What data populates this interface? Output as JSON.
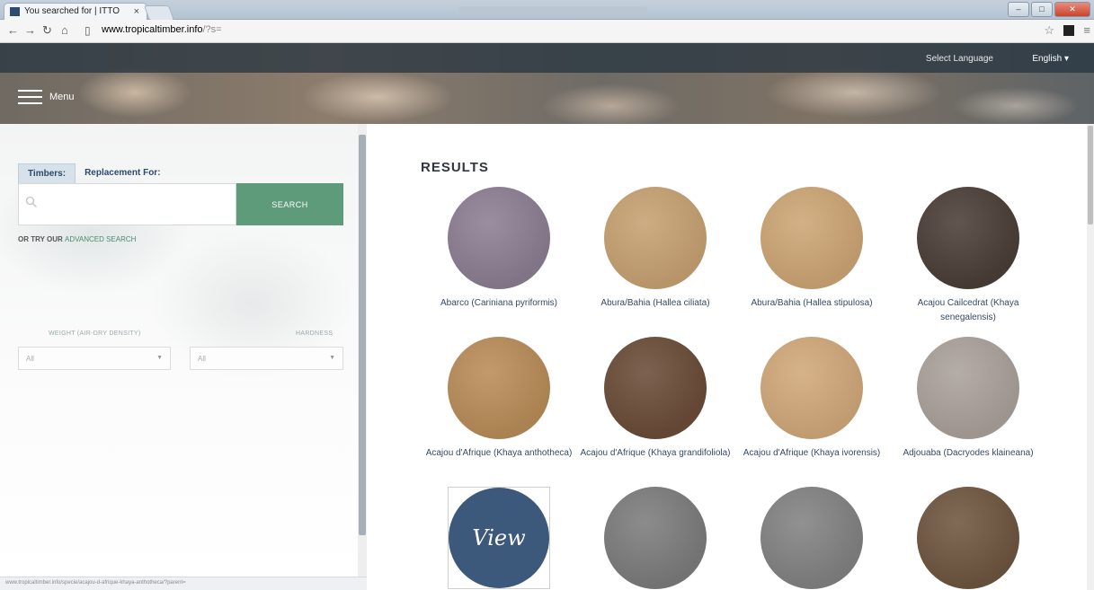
{
  "browser": {
    "tab_title": "You searched for | ITTO",
    "tab_close": "×",
    "url_domain": "www.tropicaltimber.info",
    "url_path": "/?s=",
    "win_min": "–",
    "win_max": "□",
    "win_close": "✕"
  },
  "header": {
    "language_label": "Select Language",
    "language_value": "English ▾",
    "menu_label": "Menu"
  },
  "search": {
    "tabs": [
      "Timbers:",
      "Replacement For:"
    ],
    "placeholder": "",
    "button_label": "SEARCH",
    "advanced_prefix": "OR TRY OUR ",
    "advanced_link": "ADVANCED SEARCH"
  },
  "filters": {
    "weight_label": "WEIGHT (AIR-DRY DENSITY)",
    "hardness_label": "HARDNESS",
    "weight_value": "All",
    "hardness_value": "All"
  },
  "results": {
    "title": "RESULTS",
    "items": [
      {
        "name": "Abarco (Cariniana pyriformis)",
        "color": "#8c7e92"
      },
      {
        "name": "Abura/Bahia (Hallea ciliata)",
        "color": "#c7a172"
      },
      {
        "name": "Abura/Bahia (Hallea stipulosa)",
        "color": "#cda575"
      },
      {
        "name": "Acajou Cailcedrat (Khaya senegalensis)",
        "color": "#4b3f37"
      },
      {
        "name": "Acajou d'Afrique (Khaya anthotheca)",
        "color": "#b98c58"
      },
      {
        "name": "Acajou d'Afrique (Khaya grandifoliola)",
        "color": "#6b4c38"
      },
      {
        "name": "Acajou d'Afrique (Khaya ivorensis)",
        "color": "#d1a87a"
      },
      {
        "name": "Adjouaba (Dacryodes klaineana)",
        "color": "#aaa19a"
      },
      {
        "name": "",
        "color": "#3c587a",
        "view_label": "View"
      },
      {
        "name": "",
        "color": "#7c7c7c"
      },
      {
        "name": "",
        "color": "#828282"
      },
      {
        "name": "",
        "color": "#6f563f"
      }
    ]
  },
  "status_bar": "www.tropicaltimber.info/specie/acajou-d-afrique-khaya-anthotheca/?parent="
}
